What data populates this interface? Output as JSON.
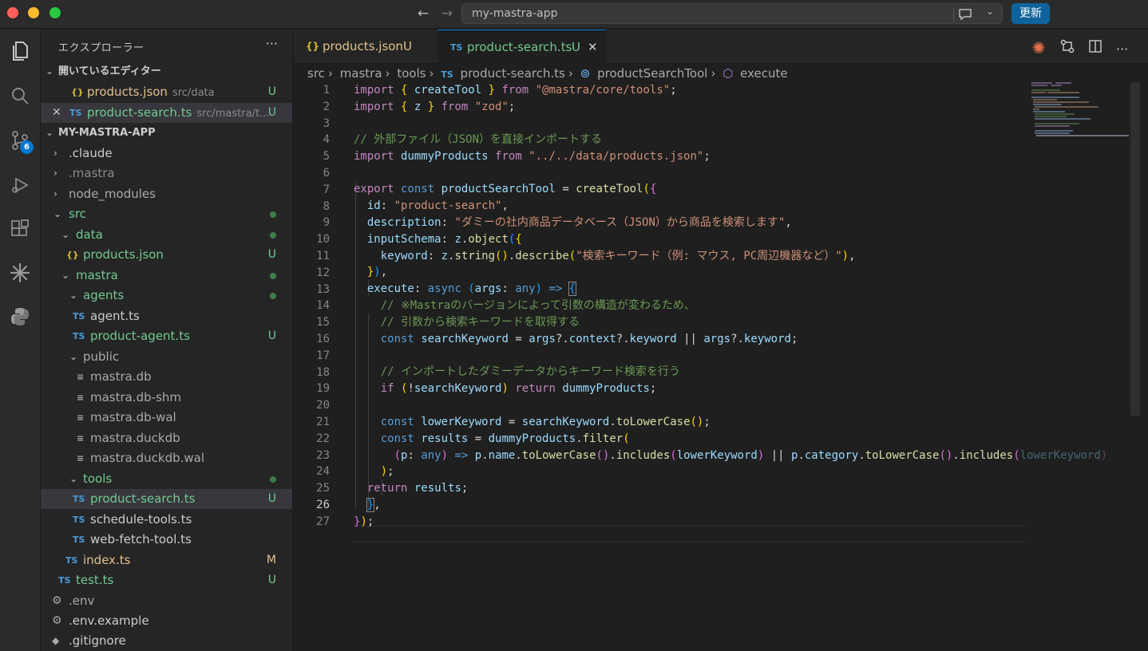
{
  "titlebar": {
    "search_text": "my-mastra-app",
    "update_button": "更新"
  },
  "sidebar": {
    "title": "エクスプローラー",
    "open_editors_label": "開いているエディター",
    "open_editors": [
      {
        "name": "products.json",
        "desc": "src/data",
        "status": "U"
      },
      {
        "name": "product-search.ts",
        "desc": "src/mastra/t...",
        "status": "U"
      }
    ],
    "project_label": "MY-MASTRA-APP",
    "tree": [
      {
        "name": ".claude"
      },
      {
        "name": ".mastra"
      },
      {
        "name": "node_modules"
      },
      {
        "name": "src"
      },
      {
        "name": "data"
      },
      {
        "name": "products.json",
        "status": "U"
      },
      {
        "name": "mastra"
      },
      {
        "name": "agents"
      },
      {
        "name": "agent.ts"
      },
      {
        "name": "product-agent.ts",
        "status": "U"
      },
      {
        "name": "public"
      },
      {
        "name": "mastra.db"
      },
      {
        "name": "mastra.db-shm"
      },
      {
        "name": "mastra.db-wal"
      },
      {
        "name": "mastra.duckdb"
      },
      {
        "name": "mastra.duckdb.wal"
      },
      {
        "name": "tools"
      },
      {
        "name": "product-search.ts",
        "status": "U"
      },
      {
        "name": "schedule-tools.ts"
      },
      {
        "name": "web-fetch-tool.ts"
      },
      {
        "name": "index.ts",
        "status": "M"
      },
      {
        "name": "test.ts",
        "status": "U"
      },
      {
        "name": ".env"
      },
      {
        "name": ".env.example"
      },
      {
        "name": ".gitignore"
      }
    ],
    "scm_badge": "6"
  },
  "tabs": [
    {
      "name": "products.json",
      "status": "U"
    },
    {
      "name": "product-search.ts",
      "status": "U"
    }
  ],
  "breadcrumb": [
    "src",
    "mastra",
    "tools",
    "product-search.ts",
    "productSearchTool",
    "execute"
  ],
  "code": {
    "line_numbers": [
      "1",
      "2",
      "3",
      "4",
      "5",
      "6",
      "7",
      "8",
      "9",
      "10",
      "11",
      "12",
      "13",
      "14",
      "15",
      "16",
      "17",
      "18",
      "19",
      "20",
      "21",
      "22",
      "23",
      "24",
      "25",
      "26",
      "27"
    ],
    "l1": [
      "import",
      " { ",
      "createTool",
      " } ",
      "from",
      " ",
      "\"@mastra/core/tools\"",
      ";"
    ],
    "l2": [
      "import",
      " { ",
      "z",
      " } ",
      "from",
      " ",
      "\"zod\"",
      ";"
    ],
    "l4": "// 外部ファイル（JSON）を直接インポートする",
    "l5": [
      "import",
      " ",
      "dummyProducts",
      " ",
      "from",
      " ",
      "\"../../data/products.json\"",
      ";"
    ],
    "l7": [
      "export",
      " ",
      "const",
      " ",
      "productSearchTool",
      " = ",
      "createTool",
      "(",
      "{"
    ],
    "l8": [
      "id",
      ": ",
      "\"product-search\"",
      ","
    ],
    "l9": [
      "description",
      ": ",
      "\"ダミーの社内商品データベース（JSON）から商品を検索します\"",
      ","
    ],
    "l10": [
      "inputSchema",
      ": ",
      "z",
      ".",
      "object",
      "(",
      "{"
    ],
    "l11": [
      "keyword",
      ": ",
      "z",
      ".",
      "string",
      "()",
      ".",
      "describe",
      "(",
      "\"検索キーワード（例: マウス, PC周辺機器など）\"",
      ")",
      ","
    ],
    "l12": [
      "}",
      ")",
      ","
    ],
    "l13": [
      "execute",
      ": ",
      "async",
      " ",
      "(",
      "args",
      ": ",
      "any",
      ")",
      " => ",
      "{"
    ],
    "l14": "// ※Mastraのバージョンによって引数の構造が変わるため、",
    "l15": "// 引数から検索キーワードを取得する",
    "l16": [
      "const",
      " ",
      "searchKeyword",
      " = ",
      "args",
      "?.",
      "context",
      "?.",
      "keyword",
      " || ",
      "args",
      "?.",
      "keyword",
      ";"
    ],
    "l18": "// インポートしたダミーデータからキーワード検索を行う",
    "l19": [
      "if",
      " (",
      "!",
      "searchKeyword",
      ") ",
      "return",
      " ",
      "dummyProducts",
      ";"
    ],
    "l21": [
      "const",
      " ",
      "lowerKeyword",
      " = ",
      "searchKeyword",
      ".",
      "toLowerCase",
      "()",
      ";"
    ],
    "l22": [
      "const",
      " ",
      "results",
      " = ",
      "dummyProducts",
      ".",
      "filter",
      "("
    ],
    "l23": [
      "(",
      "p",
      ": ",
      "any",
      ")",
      " => ",
      "p",
      ".",
      "name",
      ".",
      "toLowerCase",
      "()",
      ".",
      "includes",
      "(",
      "lowerKeyword",
      ")",
      " || ",
      "p",
      ".",
      "category",
      ".",
      "toLowerCase",
      "()",
      ".",
      "includes",
      "(",
      "lowerKeyword",
      ")"
    ],
    "l24": [
      ")",
      ";"
    ],
    "l25": [
      "return",
      " ",
      "results",
      ";"
    ],
    "l26": [
      "}",
      ","
    ],
    "l27": [
      "}",
      ")",
      ";"
    ]
  }
}
